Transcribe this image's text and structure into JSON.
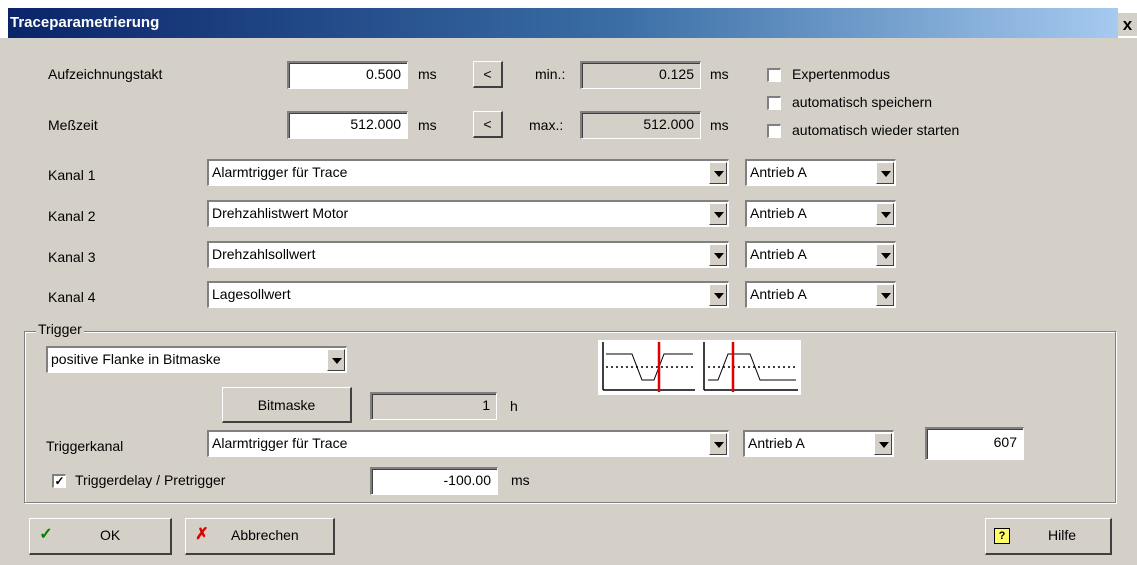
{
  "window": {
    "title": "Traceparametrierung",
    "close_label": "x"
  },
  "timing": {
    "aufzeichnungstakt_label": "Aufzeichnungstakt",
    "aufzeichnungstakt_value": "0.500",
    "messzeit_label": "Meßzeit",
    "messzeit_value": "512.000",
    "unit": "ms",
    "arrow_label": "<",
    "min_label": "min.:",
    "min_value": "0.125",
    "max_label": "max.:",
    "max_value": "512.000"
  },
  "options": [
    {
      "label": "Expertenmodus",
      "checked": false
    },
    {
      "label": "automatisch speichern",
      "checked": false
    },
    {
      "label": "automatisch wieder starten",
      "checked": false
    }
  ],
  "channels": [
    {
      "label": "Kanal 1",
      "signal": "Alarmtrigger für Trace",
      "drive": "Antrieb A"
    },
    {
      "label": "Kanal 2",
      "signal": "Drehzahlistwert Motor",
      "drive": "Antrieb A"
    },
    {
      "label": "Kanal 3",
      "signal": "Drehzahlsollwert",
      "drive": "Antrieb A"
    },
    {
      "label": "Kanal 4",
      "signal": "Lagesollwert",
      "drive": "Antrieb A"
    }
  ],
  "trigger": {
    "group_label": "Trigger",
    "mode": "positive Flanke in Bitmaske",
    "bitmaske_button": "Bitmaske",
    "bitmaske_value": "1",
    "bitmaske_unit": "h",
    "triggerkanal_label": "Triggerkanal",
    "triggerkanal_signal": "Alarmtrigger für Trace",
    "triggerkanal_drive": "Antrieb A",
    "triggerkanal_value": "607",
    "delay_label": "Triggerdelay / Pretrigger",
    "delay_checked": true,
    "delay_value": "-100.00",
    "delay_unit": "ms",
    "check_mark": "✓"
  },
  "buttons": {
    "ok": "OK",
    "cancel": "Abbrechen",
    "help": "Hilfe"
  },
  "colors": {
    "title_bar": "#0a246a",
    "dialog_bg": "#d4d0c8",
    "trigger_marker": "#e00000"
  }
}
